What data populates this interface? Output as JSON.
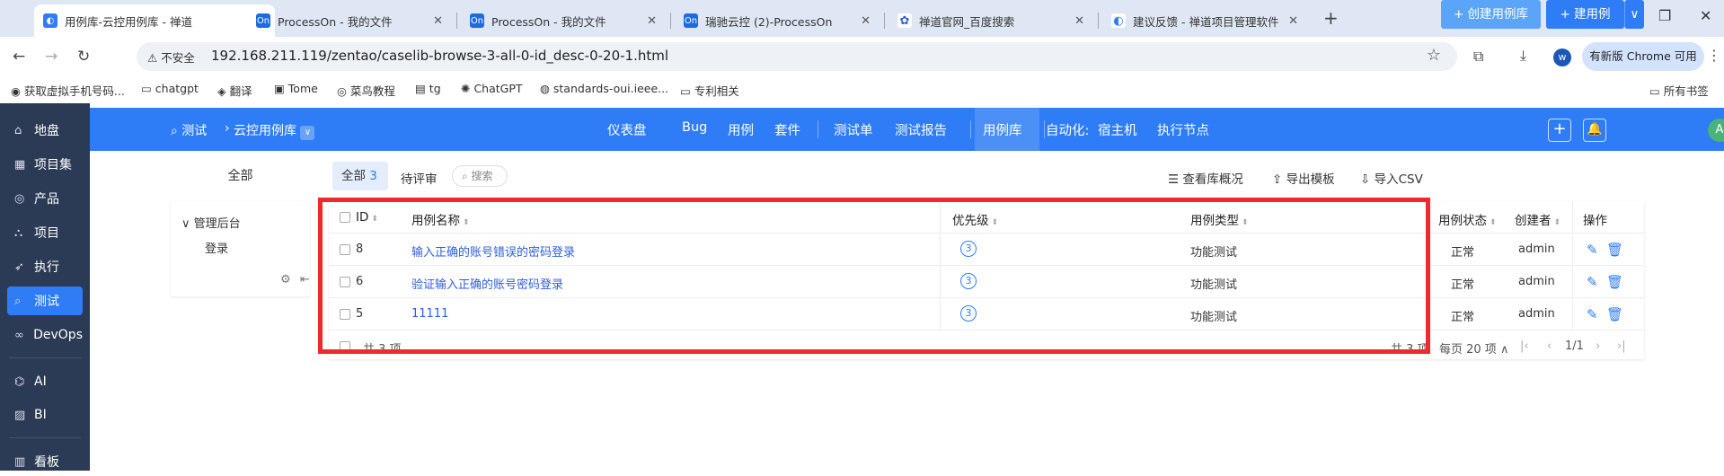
{
  "browser": {
    "tabs": [
      {
        "title": "用例库-云控用例库 - 禅道",
        "icon": "zentao-icon",
        "active": true
      },
      {
        "title": "ProcessOn - 我的文件",
        "icon": "processon-icon"
      },
      {
        "title": "ProcessOn - 我的文件",
        "icon": "processon-icon"
      },
      {
        "title": "瑞驰云控 (2)-ProcessOn",
        "icon": "processon-icon"
      },
      {
        "title": "禅道官网_百度搜索",
        "icon": "baidu-icon"
      },
      {
        "title": "建议反馈 - 禅道项目管理软件",
        "icon": "zentao-icon"
      }
    ],
    "security_label": "不安全",
    "url": "192.168.211.119/zentao/caselib-browse-3-all-0-id_desc-0-20-1.html",
    "profile_initial": "w",
    "update_label": "有新版 Chrome 可用",
    "bookmarks": [
      "获取虚拟手机号码...",
      "chatgpt",
      "翻译",
      "Tome",
      "菜鸟教程",
      "tg",
      "ChatGPT",
      "standards-oui.ieee...",
      "专利相关"
    ],
    "all_bookmarks": "所有书签"
  },
  "sidebar": {
    "items": [
      {
        "label": "地盘",
        "icon": "home-icon"
      },
      {
        "label": "项目集",
        "icon": "grid-icon"
      },
      {
        "label": "产品",
        "icon": "location-icon"
      },
      {
        "label": "项目",
        "icon": "project-icon"
      },
      {
        "label": "执行",
        "icon": "run-icon"
      },
      {
        "label": "测试",
        "icon": "search-icon",
        "active": true
      },
      {
        "label": "DevOps",
        "icon": "infinity-icon"
      },
      {
        "label": "AI",
        "icon": "robot-icon"
      },
      {
        "label": "BI",
        "icon": "chart-icon"
      },
      {
        "label": "看板",
        "icon": "board-icon"
      }
    ]
  },
  "topnav": {
    "crumb_root": "测试",
    "crumb_current": "云控用例库",
    "items": [
      "仪表盘",
      "Bug",
      "用例",
      "套件",
      "测试单",
      "测试报告",
      "用例库",
      "自动化:",
      "宿主机",
      "执行节点"
    ],
    "active": "用例库",
    "avatar": "A"
  },
  "toolbar": {
    "all_pill": "全部",
    "tab_all": "全部",
    "tab_all_count": "3",
    "tab_pending": "待评审",
    "search_placeholder": "搜索",
    "view_lib": "查看库概况",
    "export_template": "导出模板",
    "import_csv": "导入CSV",
    "create_lib": "+ 创建用例库",
    "create_case": "+ 建用例"
  },
  "tree": {
    "root": "管理后台",
    "child": "登录"
  },
  "table": {
    "headers": [
      "ID",
      "用例名称",
      "优先级",
      "用例类型",
      "用例状态",
      "创建者",
      "操作"
    ],
    "rows": [
      {
        "id": "8",
        "name": "输入正确的账号错误的密码登录",
        "priority": "3",
        "type": "功能测试",
        "status": "正常",
        "creator": "admin"
      },
      {
        "id": "6",
        "name": "验证输入正确的账号密码登录",
        "priority": "3",
        "type": "功能测试",
        "status": "正常",
        "creator": "admin"
      },
      {
        "id": "5",
        "name": "11111",
        "priority": "3",
        "type": "功能测试",
        "status": "正常",
        "creator": "admin"
      }
    ],
    "footer_left": "共 3 项",
    "footer_right": "共 3 项",
    "per_page": "每页 20 项",
    "page": "1/1"
  },
  "colors": {
    "accent": "#2e7cf6",
    "sidebar": "#2b3a55",
    "highlight": "#ee2a2f"
  }
}
